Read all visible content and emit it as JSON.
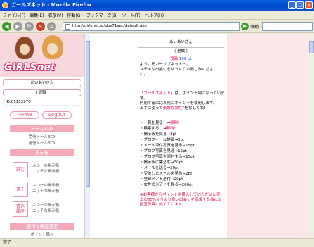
{
  "window": {
    "title": "ガールズネット - Mozilla Firefox"
  },
  "menu": [
    "ファイル(F)",
    "編集(E)",
    "表示(V)",
    "移動(G)",
    "ブックマーク(B)",
    "ツール(T)",
    "ヘルプ(H)"
  ],
  "toolbar": {
    "url": "http://girlsnet.jp/pbv71vec/default.asp",
    "go_label": "移動"
  },
  "status": {
    "text": "完了"
  },
  "left": {
    "logo_text": "GIRLSnet",
    "user_name": "あいあいさん",
    "status_label": "( 退職 )",
    "user_id": "ID:01152970",
    "home_btn": "Home",
    "logout_btn": "Logout",
    "mailbox_header": "メールBOX",
    "mailbox_items": [
      "受信メールBOX",
      "送信メールBOX"
    ],
    "board_header": "掲示板",
    "board_read": "読む",
    "board_read_items": [
      "ふつーの掲示板",
      "エッチな掲示板"
    ],
    "board_write": "書く",
    "board_write_items": [
      "ふつーの掲示板",
      "エッチな掲示板"
    ],
    "board_history": "書込\n履歴",
    "board_history_items": [
      "ふつーの掲示板",
      "エッチな掲示板"
    ],
    "settings_header": "便利な機能設定",
    "settings_sub": "ポイント購入"
  },
  "center": {
    "user_name": "あいあいさん",
    "status_label": "( 退職 )",
    "points_label": "残高",
    "points_value": "100 pt",
    "welcome1": "ようこそガールズネットへ。",
    "welcome2": "ステキな出会いをゆっくりお楽しみくださ",
    "welcome3": "い。",
    "intro_red": "「ガールズネット」",
    "intro1": "は、ポイント制になっていま",
    "intro2": "す。",
    "intro3": "利用するにはお先にポイントを使用します。",
    "intro4_pre": "上手に使って",
    "intro4_red": "素敵な女性♪",
    "intro4_post": "を探してね！",
    "price_list": [
      {
        "label": "・一覧を見る　→",
        "value": "無料!",
        "red": true
      },
      {
        "label": "・検索する　→",
        "value": "無料!",
        "red": true
      },
      {
        "label": "・掲示板を見る",
        "value": "→3pt",
        "red": false
      },
      {
        "label": "・プロフィール詳細",
        "value": "→3pt",
        "red": false
      },
      {
        "label": "・メール添付写真を見る",
        "value": "→15pt",
        "red": false
      },
      {
        "label": "・プロフ写真を見る",
        "value": "→15pt",
        "red": false
      },
      {
        "label": "・プロフ写真を添付する",
        "value": "→15pt",
        "red": false
      },
      {
        "label": "・掲示板に書込む",
        "value": "→30pt",
        "red": false
      },
      {
        "label": "・メールを送る",
        "value": "→20pt",
        "red": false
      },
      {
        "label": "・受信したメールを見る",
        "value": "→2pt",
        "red": false
      },
      {
        "label": "・登録メアド送付",
        "value": "→20pt",
        "red": false
      },
      {
        "label": "・女性のメアドを見る",
        "value": "→200pt",
        "red": false
      }
    ],
    "notice1": "※お客様からポイントを購入していただいた売",
    "notice2": "上の85%よりより良い出会いを応援する為に広",
    "notice3": "告宣伝費に充てています。"
  }
}
